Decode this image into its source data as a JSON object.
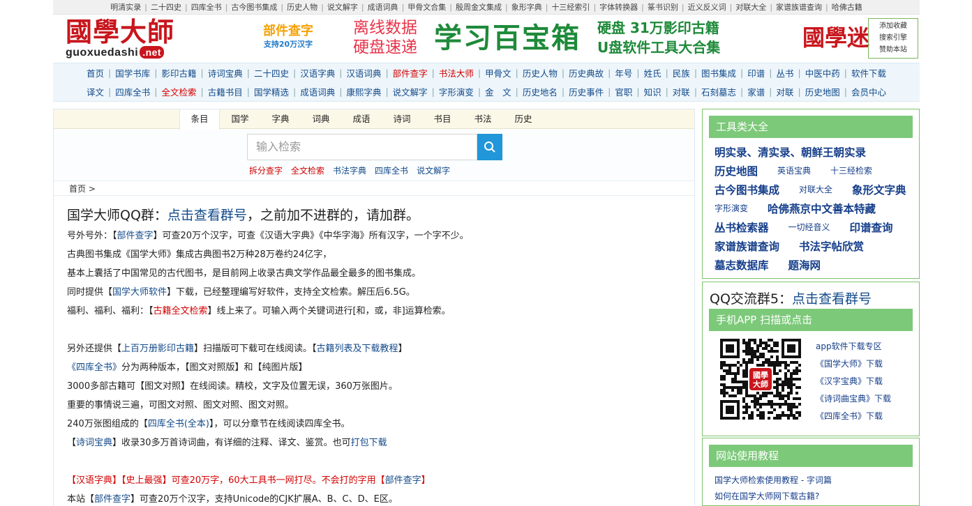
{
  "top_links": [
    "明清实录",
    "二十四史",
    "四库全书",
    "古今图书集成",
    "历史人物",
    "说文解字",
    "成语词典",
    "甲骨文合集",
    "殷周金文集成",
    "象形字典",
    "十三经索引",
    "字体转换器",
    "篆书识别",
    "近义反义词",
    "对联大全",
    "家谱族谱查询",
    "哈佛古籍"
  ],
  "banner": {
    "logo_cn": "國學大師",
    "logo_en": "guoxuedashi",
    "logo_net": ".net",
    "bujian_title": "部件查字",
    "bujian_sub": "支持20万汉字",
    "offline_1": "离线数据",
    "offline_2": "硬盘速递",
    "baibao": "学习百宝箱",
    "disk_1": "硬盘 31万影印古籍",
    "disk_2": "U盘软件工具大合集",
    "guoxuemi": "國學迷",
    "fav_1": "添加收藏",
    "fav_2": "搜索引擎",
    "fav_3": "赞助本站"
  },
  "nav": {
    "row1": [
      {
        "label": "首页"
      },
      {
        "label": "国学书库"
      },
      {
        "label": "影印古籍"
      },
      {
        "label": "诗词宝典"
      },
      {
        "label": "二十四史"
      },
      {
        "label": "汉语字典"
      },
      {
        "label": "汉语词典"
      },
      {
        "label": "部件查字",
        "red": true
      },
      {
        "label": "书法大师",
        "red": true
      },
      {
        "label": "甲骨文"
      },
      {
        "label": "历史人物"
      },
      {
        "label": "历史典故"
      },
      {
        "label": "年号"
      },
      {
        "label": "姓氏"
      },
      {
        "label": "民族"
      },
      {
        "label": "图书集成"
      },
      {
        "label": "印谱"
      },
      {
        "label": "丛书"
      },
      {
        "label": "中医中药"
      },
      {
        "label": "软件下载"
      }
    ],
    "row2": [
      {
        "label": "译文"
      },
      {
        "label": "四库全书"
      },
      {
        "label": "全文检索",
        "red": true
      },
      {
        "label": "古籍书目"
      },
      {
        "label": "国学精选"
      },
      {
        "label": "成语词典"
      },
      {
        "label": "康熙字典"
      },
      {
        "label": "说文解字"
      },
      {
        "label": "字形演变"
      },
      {
        "label": "金　文"
      },
      {
        "label": "历史地名"
      },
      {
        "label": "历史事件"
      },
      {
        "label": "官职"
      },
      {
        "label": "知识"
      },
      {
        "label": "对联"
      },
      {
        "label": "石刻墓志"
      },
      {
        "label": "家谱"
      },
      {
        "label": "对联"
      },
      {
        "label": "历史地图"
      },
      {
        "label": "会员中心"
      }
    ]
  },
  "tabs": [
    "条目",
    "国学",
    "字典",
    "词典",
    "成语",
    "诗词",
    "书目",
    "书法",
    "历史"
  ],
  "search": {
    "placeholder": "输入检索",
    "quick": [
      {
        "label": "拆分查字",
        "red": true
      },
      {
        "label": "全文检索",
        "red": true
      },
      {
        "label": "书法字典"
      },
      {
        "label": "四库全书"
      },
      {
        "label": "说文解字"
      }
    ]
  },
  "breadcrumb": "首页 >",
  "article": {
    "headline_pre": "国学大师QQ群：",
    "headline_link": "点击查看群号",
    "headline_post": "，之前加不进群的，请加群。",
    "l1a": "号外号外：【",
    "l1b": "部件查字",
    "l1c": "】可查20万个汉字，可查《汉语大字典》《中华字海》所有汉字，一个字不少。",
    "l2": "古典图书集成《国学大师》集成古典图书2万种28万卷约24亿字，",
    "l3": "基本上囊括了中国常见的古代图书，是目前网上收录古典文学作品最全最多的图书集成。",
    "l4a": "同时提供【",
    "l4b": "国学大师软件",
    "l4c": "】下载，已经整理编写好软件，支持全文检索。解压后6.5G。",
    "l5a": "福利、福利、福利：【",
    "l5b": "古籍全文检索",
    "l5c": "】线上来了。可输入两个关键词进行[和，或，非]运算检索。",
    "l6a": "另外还提供【",
    "l6b": "上百万册影印古籍",
    "l6c": "】扫描版可下载可在线阅读。【",
    "l6d": "古籍列表及下载教程",
    "l6e": "】",
    "l7a": "《四库全书》",
    "l7b": "分为两种版本，【图文对照版】和【纯图片版】",
    "l8": "3000多部古籍可【图文对照】在线阅读。精校，文字及位置无误，360万张图片。",
    "l9": "重要的事情说三遍，可图文对照、图文对照、图文对照。",
    "l10a": "240万张图组成的【",
    "l10b": "四库全书(全本)",
    "l10c": "】，可以分章节在线阅读四库全书。",
    "l11a": "【",
    "l11b": "诗词宝典",
    "l11c": "】收录30多万首诗词曲，有详细的注释、译文、鉴赏。也可",
    "l11d": "打包下载",
    "l12a": "【",
    "l12b": "汉语字典",
    "l12c": "】【",
    "l12d": "史上最强",
    "l12e": "】可查20万字，60大工具书一网打尽。不会打的字用【",
    "l12f": "部件查字",
    "l12g": "】",
    "l13a": "本站【",
    "l13b": "部件查字",
    "l13c": "】可查20万个汉字，支持Unicode的CJK扩展A、B、C、D、E区。"
  },
  "sidebar": {
    "tools_title": "工具类大全",
    "tools": [
      [
        {
          "label": "明实录、清实录、朝鲜王朝实录",
          "big": true
        }
      ],
      [
        {
          "label": "历史地图",
          "big": true
        },
        {
          "label": "英语宝典"
        },
        {
          "label": "十三经检索"
        }
      ],
      [
        {
          "label": "古今图书集成",
          "big": true
        },
        {
          "label": "对联大全"
        },
        {
          "label": "象形文字典",
          "big": true
        }
      ],
      [
        {
          "label": "字形演变"
        },
        {
          "label": "哈佛燕京中文善本特藏",
          "big": true
        }
      ],
      [
        {
          "label": "丛书检索器",
          "big": true
        },
        {
          "label": "一切经音义"
        },
        {
          "label": "印谱查询",
          "big": true
        }
      ],
      [
        {
          "label": "家谱族谱查询",
          "big": true
        },
        {
          "label": "书法字帖欣赏",
          "big": true
        }
      ],
      [
        {
          "label": "墓志数据库",
          "big": true
        },
        {
          "label": "题海网",
          "big": true
        }
      ]
    ],
    "qq_pre": "QQ交流群5：",
    "qq_link": "点击查看群号",
    "app_title": "手机APP 扫描或点击",
    "qr_text": "國學大師",
    "app_links": [
      "app软件下载专区",
      "《国学大师》下载",
      "《汉字宝典》下载",
      "《诗词曲宝典》下载",
      "《四库全书》下载"
    ],
    "tutorial_title": "网站使用教程",
    "tutorials": [
      "国学大师检索使用教程 - 字词篇",
      "如何在国学大师网下载古籍?"
    ]
  },
  "colors": {
    "accent_red": "#c8161d",
    "link_blue": "#134a8a",
    "side_green": "#7cc979",
    "search_blue": "#2196d8"
  }
}
